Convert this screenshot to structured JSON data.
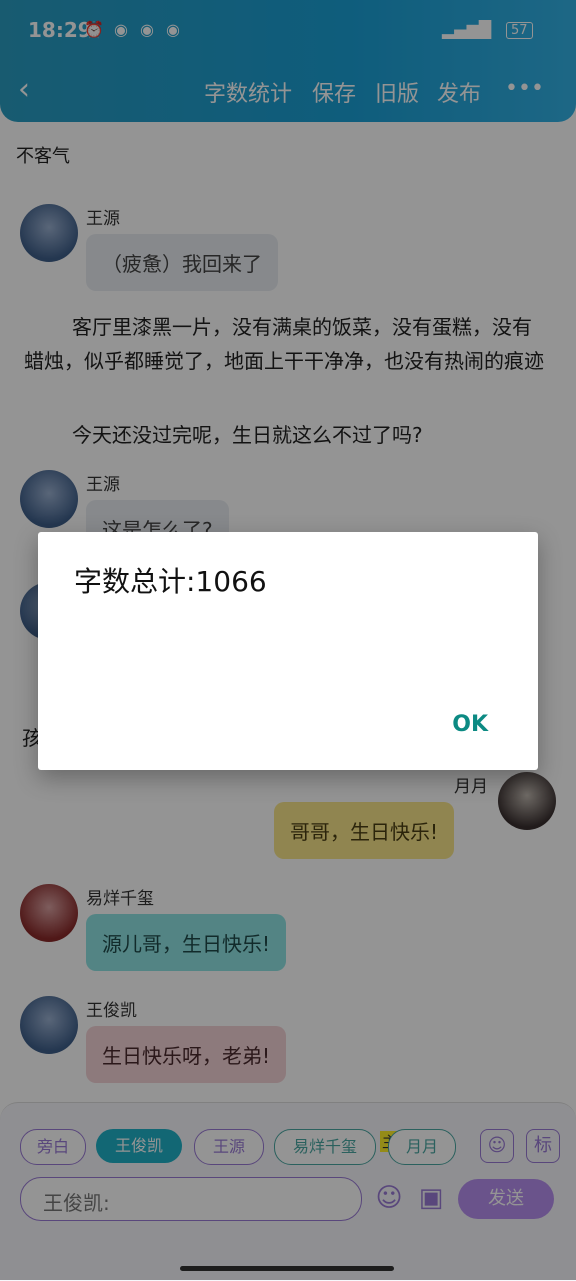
{
  "status_bar": {
    "time": "18:29",
    "battery": "57"
  },
  "toolbar": {
    "back_icon": "chevron-left-icon",
    "word_count": "字数统计",
    "save": "保存",
    "old_version": "旧版",
    "publish": "发布",
    "more": "•••"
  },
  "chat": {
    "line_top": "不客气",
    "msg1": {
      "name": "王源",
      "text": "（疲惫）我回来了"
    },
    "para1": "客厅里漆黑一片，没有满桌的饭菜，没有蛋糕，没有蜡烛，似乎都睡觉了，地面上干干净净，也没有热闹的痕迹",
    "para2": "今天还没过完呢，生日就这么不过了吗?",
    "msg2": {
      "name": "王源",
      "text": "这是怎么了?"
    },
    "partial_char": "孩",
    "msg3": {
      "name": "月月",
      "text": "哥哥，生日快乐!"
    },
    "msg4": {
      "name": "易烊千玺",
      "text": "源儿哥，生日快乐!"
    },
    "msg5": {
      "name": "王俊凯",
      "text": "生日快乐呀，老弟!"
    }
  },
  "composer": {
    "chips": [
      "旁白",
      "王俊凯",
      "王源",
      "易烊千玺",
      "月月"
    ],
    "mark": "主",
    "input_value": "王俊凯:",
    "send": "发送",
    "icon_person": "person-icon",
    "icon_tag": "标"
  },
  "dialog": {
    "title": "字数总计:1066",
    "ok": "OK"
  }
}
